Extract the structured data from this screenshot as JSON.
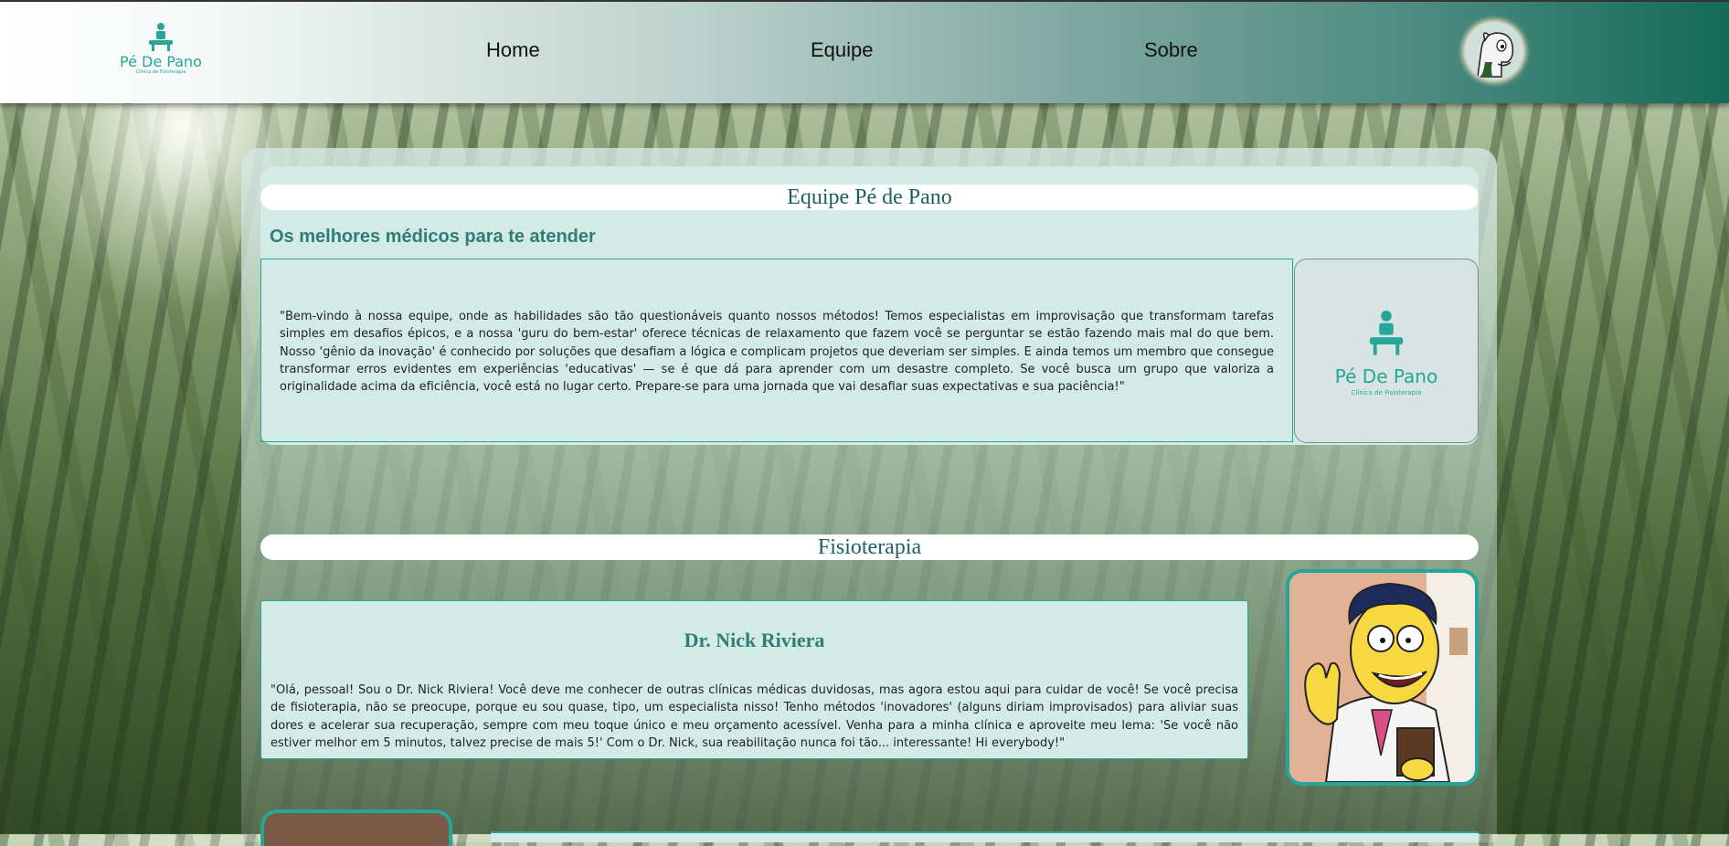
{
  "header": {
    "logo": {
      "brand": "Pé De Pano",
      "tagline": "Clínica de Fisioterapia",
      "icon": "physio-logo-icon"
    },
    "nav": [
      {
        "label": "Home"
      },
      {
        "label": "Equipe"
      },
      {
        "label": "Sobre"
      }
    ],
    "avatar_icon": "horse-avatar-icon"
  },
  "team": {
    "title": "Equipe Pé de Pano",
    "subtitle": "Os melhores médicos para te atender",
    "description": "\"Bem-vindo à nossa equipe, onde as habilidades são tão questionáveis quanto nossos métodos! Temos especialistas em improvisação que transformam tarefas simples em desafios épicos, e a nossa 'guru do bem-estar' oferece técnicas de relaxamento que fazem você se perguntar se estão fazendo mais mal do que bem. Nosso 'gênio da inovação' é conhecido por soluções que desafiam a lógica e complicam projetos que deveriam ser simples. E ainda temos um membro que consegue transformar erros evidentes em experiências 'educativas' — se é que dá para aprender com um desastre completo. Se você busca um grupo que valoriza a originalidade acima da eficiência, você está no lugar certo. Prepare-se para uma jornada que vai desafiar suas expectativas e sua paciência!\"",
    "logo_card": {
      "brand": "Pé De Pano",
      "tagline": "Clínica de Fisioterapia"
    }
  },
  "fisioterapia": {
    "title": "Fisioterapia",
    "doctor": {
      "name": "Dr. Nick Riviera",
      "bio": "\"Olá, pessoal! Sou o Dr. Nick Riviera! Você deve me conhecer de outras clínicas médicas duvidosas, mas agora estou aqui para cuidar de você! Se você precisa de fisioterapia, não se preocupe, porque eu sou quase, tipo, um especialista nisso! Tenho métodos 'inovadores' (alguns diriam improvisados) para aliviar suas dores e acelerar sua recuperação, sempre com meu toque único e meu orçamento acessível. Venha para a minha clínica e aproveite meu lema: 'Se você não estiver melhor em 5 minutos, talvez precise de mais 5!' Com o Dr. Nick, sua reabilitação nunca foi tão... interessante! Hi everybody!\"",
      "photo_icon": "cartoon-doctor-portrait"
    }
  },
  "colors": {
    "accent": "#26a69a",
    "heading": "#2f7d73",
    "header_dark": "#146a5a"
  }
}
